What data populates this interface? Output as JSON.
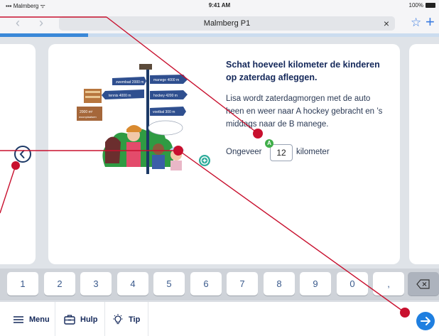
{
  "status_bar": {
    "carrier": "Malmberg",
    "time": "9:41 AM",
    "battery": "100%"
  },
  "browser": {
    "url_title": "Malmberg P1"
  },
  "progress": {
    "fraction": 0.2
  },
  "illustration_signs": [
    "2000 m²",
    "woonplaatsen",
    "manege 4000 m",
    "zwembad 2000 m",
    "tennis 4000 m",
    "hockey 4200 m",
    "voetbal 300 m"
  ],
  "exercise": {
    "title": "Schat hoeveel kilometer de kinderen op zaterdag afleggen.",
    "body": "Lisa wordt zaterdagmorgen met de auto heen en weer naar A hockey gebracht en ’s middags naar de B manege.",
    "answer_prefix": "Ongeveer",
    "answer_value": "12",
    "answer_suffix": "kilometer",
    "badge": "A"
  },
  "keypad": {
    "keys": [
      "1",
      "2",
      "3",
      "4",
      "5",
      "6",
      "7",
      "8",
      "9",
      "0",
      ","
    ]
  },
  "toolbar": {
    "menu_label": "Menu",
    "hulp_label": "Hulp",
    "tip_label": "Tip"
  },
  "colors": {
    "accent": "#1f7fe0",
    "annotation": "#c8102e",
    "navy": "#14285a"
  }
}
